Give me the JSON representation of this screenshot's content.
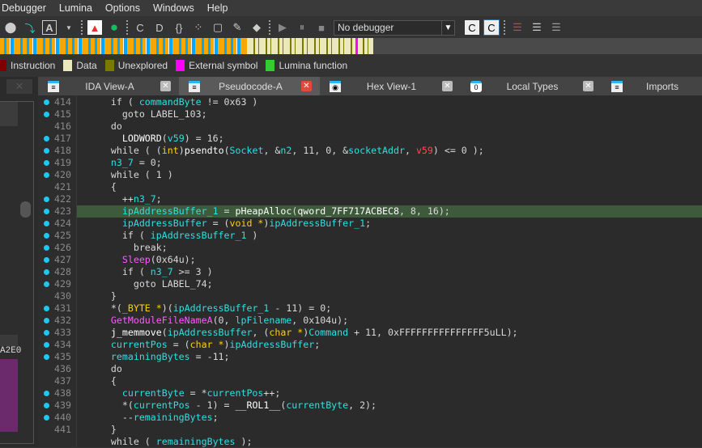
{
  "menu": [
    "Debugger",
    "Lumina",
    "Options",
    "Windows",
    "Help"
  ],
  "toolbar": {
    "debugger_select": "No debugger"
  },
  "legend": [
    {
      "label": "Instruction",
      "color": "#800000"
    },
    {
      "label": "Data",
      "color": "#ebe9bc"
    },
    {
      "label": "Unexplored",
      "color": "#7a7a00"
    },
    {
      "label": "External symbol",
      "color": "#ff00ff"
    },
    {
      "label": "Lumina function",
      "color": "#33cc33"
    }
  ],
  "left_panel": {
    "fragment": "A2E0"
  },
  "tabs": [
    {
      "label": "IDA View-A",
      "active": false,
      "closable": true
    },
    {
      "label": "Pseudocode-A",
      "active": true,
      "closable": true
    },
    {
      "label": "Hex View-1",
      "active": false,
      "closable": true
    },
    {
      "label": "Local Types",
      "active": false,
      "closable": true
    },
    {
      "label": "Imports",
      "active": false,
      "closable": false
    }
  ],
  "code": [
    {
      "n": "414",
      "dot": true,
      "t": [
        [
          "    if ( ",
          "d"
        ],
        [
          "commandByte",
          "v"
        ],
        [
          " != 0x63 )",
          "d"
        ]
      ]
    },
    {
      "n": "415",
      "dot": true,
      "t": [
        [
          "      goto LABEL_103;",
          "d"
        ]
      ]
    },
    {
      "n": "416",
      "dot": false,
      "t": [
        [
          "    do",
          "d"
        ]
      ]
    },
    {
      "n": "417",
      "dot": true,
      "t": [
        [
          "      LODWORD",
          "f"
        ],
        [
          "(",
          "d"
        ],
        [
          "v59",
          "v"
        ],
        [
          ") = 16;",
          "d"
        ]
      ]
    },
    {
      "n": "418",
      "dot": true,
      "t": [
        [
          "    while ( (",
          "d"
        ],
        [
          "int",
          "k"
        ],
        [
          ")",
          "d"
        ],
        [
          "psendto",
          "f"
        ],
        [
          "(",
          "d"
        ],
        [
          "Socket",
          "v"
        ],
        [
          ", &",
          "d"
        ],
        [
          "n2",
          "v"
        ],
        [
          ", 11, 0, &",
          "d"
        ],
        [
          "socketAddr",
          "v"
        ],
        [
          ", ",
          "d"
        ],
        [
          "v59",
          "r"
        ],
        [
          ") <= 0 );",
          "d"
        ]
      ]
    },
    {
      "n": "419",
      "dot": true,
      "t": [
        [
          "    ",
          "d"
        ],
        [
          "n3_7",
          "v"
        ],
        [
          " = 0;",
          "d"
        ]
      ]
    },
    {
      "n": "420",
      "dot": true,
      "t": [
        [
          "    while ( 1 )",
          "d"
        ]
      ]
    },
    {
      "n": "421",
      "dot": false,
      "t": [
        [
          "    {",
          "d"
        ]
      ]
    },
    {
      "n": "422",
      "dot": true,
      "t": [
        [
          "      ++",
          "d"
        ],
        [
          "n3_7",
          "v"
        ],
        [
          ";",
          "d"
        ]
      ]
    },
    {
      "n": "423",
      "dot": true,
      "hl": true,
      "t": [
        [
          "      ",
          "d"
        ],
        [
          "ipAddressBuffer_1",
          "v"
        ],
        [
          " = ",
          "d"
        ],
        [
          "pHeapAlloc",
          "f"
        ],
        [
          "(",
          "d"
        ],
        [
          "qword_7FF717ACBEC8",
          "f"
        ],
        [
          ", 8, 16);",
          "d"
        ]
      ]
    },
    {
      "n": "424",
      "dot": true,
      "t": [
        [
          "      ",
          "d"
        ],
        [
          "ipAddressBuffer",
          "v"
        ],
        [
          " = (",
          "d"
        ],
        [
          "void *",
          "k"
        ],
        [
          ")",
          "d"
        ],
        [
          "ipAddressBuffer_1",
          "v"
        ],
        [
          ";",
          "d"
        ]
      ]
    },
    {
      "n": "425",
      "dot": true,
      "t": [
        [
          "      if ( ",
          "d"
        ],
        [
          "ipAddressBuffer_1",
          "v"
        ],
        [
          " )",
          "d"
        ]
      ]
    },
    {
      "n": "426",
      "dot": true,
      "t": [
        [
          "        break;",
          "d"
        ]
      ]
    },
    {
      "n": "427",
      "dot": true,
      "t": [
        [
          "      ",
          "d"
        ],
        [
          "Sleep",
          "m"
        ],
        [
          "(0x64u);",
          "d"
        ]
      ]
    },
    {
      "n": "428",
      "dot": true,
      "t": [
        [
          "      if ( ",
          "d"
        ],
        [
          "n3_7",
          "v"
        ],
        [
          " >= 3 )",
          "d"
        ]
      ]
    },
    {
      "n": "429",
      "dot": true,
      "t": [
        [
          "        goto LABEL_74;",
          "d"
        ]
      ]
    },
    {
      "n": "430",
      "dot": false,
      "t": [
        [
          "    }",
          "d"
        ]
      ]
    },
    {
      "n": "431",
      "dot": true,
      "t": [
        [
          "    *(",
          "d"
        ],
        [
          "_BYTE *",
          "k"
        ],
        [
          ")(",
          "d"
        ],
        [
          "ipAddressBuffer_1",
          "v"
        ],
        [
          " - 11) = 0;",
          "d"
        ]
      ]
    },
    {
      "n": "432",
      "dot": true,
      "t": [
        [
          "    ",
          "d"
        ],
        [
          "GetModuleFileNameA",
          "m"
        ],
        [
          "(0, ",
          "d"
        ],
        [
          "lpFilename",
          "v"
        ],
        [
          ", 0x104u);",
          "d"
        ]
      ]
    },
    {
      "n": "433",
      "dot": true,
      "t": [
        [
          "    ",
          "d"
        ],
        [
          "j_memmove",
          "f"
        ],
        [
          "(",
          "d"
        ],
        [
          "ipAddressBuffer",
          "v"
        ],
        [
          ", (",
          "d"
        ],
        [
          "char *",
          "k"
        ],
        [
          ")",
          "d"
        ],
        [
          "Command",
          "v"
        ],
        [
          " + 11, 0xFFFFFFFFFFFFFFF5uLL);",
          "d"
        ]
      ]
    },
    {
      "n": "434",
      "dot": true,
      "t": [
        [
          "    ",
          "d"
        ],
        [
          "currentPos",
          "v"
        ],
        [
          " = (",
          "d"
        ],
        [
          "char *",
          "k"
        ],
        [
          ")",
          "d"
        ],
        [
          "ipAddressBuffer",
          "v"
        ],
        [
          ";",
          "d"
        ]
      ]
    },
    {
      "n": "435",
      "dot": true,
      "t": [
        [
          "    ",
          "d"
        ],
        [
          "remainingBytes",
          "v"
        ],
        [
          " = -11;",
          "d"
        ]
      ]
    },
    {
      "n": "436",
      "dot": false,
      "t": [
        [
          "    do",
          "d"
        ]
      ]
    },
    {
      "n": "437",
      "dot": false,
      "t": [
        [
          "    {",
          "d"
        ]
      ]
    },
    {
      "n": "438",
      "dot": true,
      "t": [
        [
          "      ",
          "d"
        ],
        [
          "currentByte",
          "v"
        ],
        [
          " = *",
          "d"
        ],
        [
          "currentPos",
          "v"
        ],
        [
          "++;",
          "d"
        ]
      ]
    },
    {
      "n": "439",
      "dot": true,
      "t": [
        [
          "      *(",
          "d"
        ],
        [
          "currentPos",
          "v"
        ],
        [
          " - 1) = ",
          "d"
        ],
        [
          "__ROL1__",
          "f"
        ],
        [
          "(",
          "d"
        ],
        [
          "currentByte",
          "v"
        ],
        [
          ", 2);",
          "d"
        ]
      ]
    },
    {
      "n": "440",
      "dot": true,
      "t": [
        [
          "      --",
          "d"
        ],
        [
          "remainingBytes",
          "v"
        ],
        [
          ";",
          "d"
        ]
      ]
    },
    {
      "n": "441",
      "dot": false,
      "t": [
        [
          "    }",
          "d"
        ]
      ]
    },
    {
      "n": "",
      "dot": false,
      "t": [
        [
          "    while ( ",
          "d"
        ],
        [
          "remainingBytes",
          "v"
        ],
        [
          " );",
          "d"
        ]
      ]
    }
  ]
}
